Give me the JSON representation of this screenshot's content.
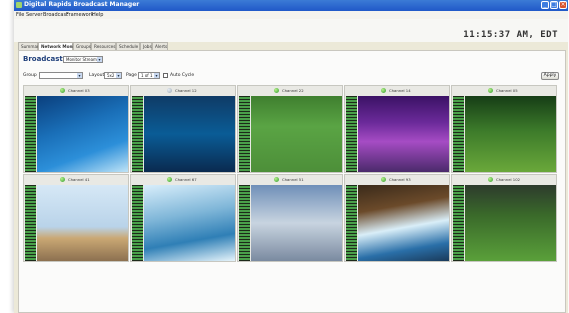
{
  "window": {
    "title": "Digital Rapids Broadcast Manager",
    "controls": [
      "_",
      "□",
      "×"
    ]
  },
  "menu": [
    "File",
    "Server",
    "Broadcast",
    "Framework",
    "Help"
  ],
  "clock": "11:15:37 AM, EDT",
  "tabs": [
    "Summary",
    "Network Monitor",
    "Groups",
    "Resources",
    "Schedule",
    "Jobs",
    "Alerts"
  ],
  "active_tab": "Network Monitor",
  "broadcast": {
    "title": "Broadcast",
    "mode_select": "Monitor Streams"
  },
  "controls": {
    "group_label": "Group",
    "group_value": "",
    "layout_label": "Layout",
    "layout_value": "5x2",
    "page_label": "Page",
    "page_value": "1 of 1",
    "autocycle_label": "Auto Cycle",
    "apply_label": "Apply"
  },
  "channels": [
    {
      "label": "Channel 03",
      "status": "ok",
      "thumb": "swim"
    },
    {
      "label": "Channel 12",
      "status": "idle",
      "thumb": "whale"
    },
    {
      "label": "Channel 22",
      "status": "ok",
      "thumb": "soccer"
    },
    {
      "label": "Channel 14",
      "status": "ok",
      "thumb": "concert"
    },
    {
      "label": "Channel 05",
      "status": "ok",
      "thumb": "golf"
    },
    {
      "label": "Channel 41",
      "status": "ok",
      "thumb": "car"
    },
    {
      "label": "Channel 67",
      "status": "ok",
      "thumb": "kayak"
    },
    {
      "label": "Channel 51",
      "status": "ok",
      "thumb": "truck"
    },
    {
      "label": "Channel 93",
      "status": "ok",
      "thumb": "raft"
    },
    {
      "label": "Channel 102",
      "status": "ok",
      "thumb": "player"
    }
  ],
  "colors": {
    "titlebar": "#2058c8",
    "status_ok": "#2e9b2e",
    "status_idle": "#9aa6b2",
    "accent": "#1f3f7a"
  }
}
